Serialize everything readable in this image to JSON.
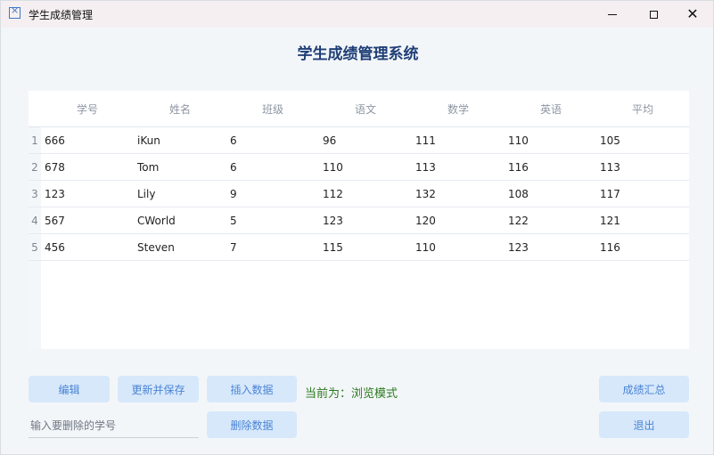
{
  "window": {
    "title": "学生成绩管理"
  },
  "heading": "学生成绩管理系统",
  "table": {
    "columns": [
      "学号",
      "姓名",
      "班级",
      "语文",
      "数学",
      "英语",
      "平均"
    ],
    "rows": [
      {
        "num": "1",
        "cells": [
          "666",
          "iKun",
          "6",
          "96",
          "111",
          "110",
          "105"
        ]
      },
      {
        "num": "2",
        "cells": [
          "678",
          "Tom",
          "6",
          "110",
          "113",
          "116",
          "113"
        ]
      },
      {
        "num": "3",
        "cells": [
          "123",
          "Lily",
          "9",
          "112",
          "132",
          "108",
          "117"
        ]
      },
      {
        "num": "4",
        "cells": [
          "567",
          "CWorld",
          "5",
          "123",
          "120",
          "122",
          "121"
        ]
      },
      {
        "num": "5",
        "cells": [
          "456",
          "Steven",
          "7",
          "115",
          "110",
          "123",
          "116"
        ]
      }
    ]
  },
  "buttons": {
    "edit": "编辑",
    "update_save": "更新并保存",
    "insert": "插入数据",
    "delete": "删除数据",
    "summary": "成绩汇总",
    "exit": "退出"
  },
  "status": "当前为：浏览模式",
  "delete_input": {
    "placeholder": "输入要删除的学号",
    "value": ""
  },
  "colors": {
    "accent": "#4a84d4",
    "button_bg": "#d7e8fb",
    "heading": "#1f3f76",
    "status": "#2b7a1e"
  }
}
